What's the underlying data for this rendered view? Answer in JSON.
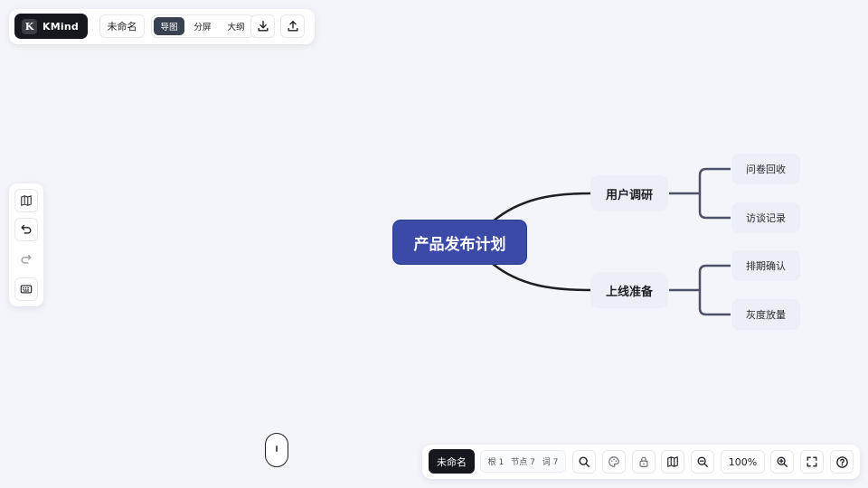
{
  "app": {
    "logo_letter": "K",
    "name": "KMind"
  },
  "document": {
    "title": "未命名"
  },
  "view_modes": [
    {
      "label": "导图",
      "active": true
    },
    {
      "label": "分屏",
      "active": false
    },
    {
      "label": "大纲",
      "active": false
    }
  ],
  "toolbar": {
    "download_icon": "download-icon",
    "upload_icon": "upload-icon"
  },
  "left_tools": [
    "map-icon",
    "undo-icon",
    "redo-icon",
    "keyboard-icon"
  ],
  "mindmap": {
    "root": "产品发布计划",
    "branches": [
      {
        "label": "用户调研",
        "children": [
          "问卷回收",
          "访谈记录"
        ]
      },
      {
        "label": "上线准备",
        "children": [
          "排期确认",
          "灰度放量"
        ]
      }
    ]
  },
  "statusbar": {
    "doc_title": "未命名",
    "stats": {
      "roots": "根 1",
      "nodes": "节点 7",
      "words": "词 7"
    },
    "zoom": "100%"
  },
  "colors": {
    "root_fill": "#3a4aa6",
    "connector_dark": "#1e1f24",
    "connector_branch": "#4a5168",
    "node_fill": "#edeff6",
    "canvas_bg": "#f4f5fa"
  }
}
